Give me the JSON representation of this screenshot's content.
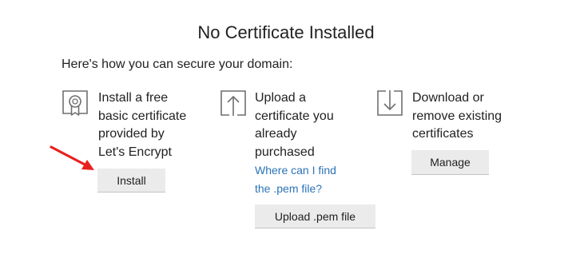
{
  "title": "No Certificate Installed",
  "intro": "Here's how you can secure your domain:",
  "options": [
    {
      "icon": "certificate-icon",
      "lines": [
        "Install a free",
        "basic certificate",
        "provided by",
        "Let's Encrypt"
      ],
      "button_label": "Install"
    },
    {
      "icon": "upload-icon",
      "lines": [
        "Upload a",
        "certificate you",
        "already",
        "purchased"
      ],
      "help_link_lines": [
        "Where can I find",
        "the .pem file?"
      ],
      "button_label": "Upload .pem file"
    },
    {
      "icon": "download-icon",
      "lines": [
        "Download or",
        "remove existing",
        "certificates"
      ],
      "button_label": "Manage"
    }
  ],
  "colors": {
    "link": "#2b73b7",
    "button_bg": "#ebebeb",
    "icon_stroke": "#6f6f6f",
    "arrow": "#e8211f"
  }
}
